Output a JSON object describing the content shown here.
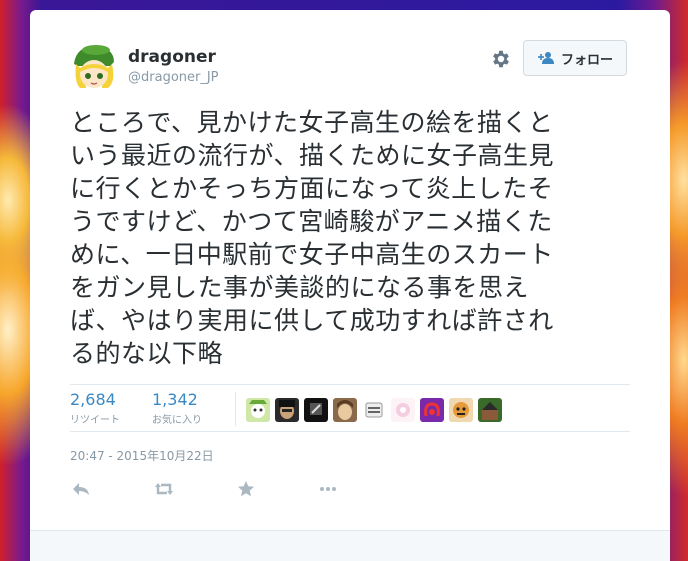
{
  "user": {
    "display_name": "dragoner",
    "handle": "@dragoner_JP"
  },
  "header": {
    "follow_label": "フォロー"
  },
  "tweet": {
    "text": "ところで、見かけた女子高生の絵を描くという最近の流行が、描くために女子高生見に行くとかそっち方面になって炎上したそうですけど、かつて宮崎駿がアニメ描くために、一日中駅前で女子中高生のスカートをガン見した事が美談的になる事を思えば、やはり実用に供して成功すれば許される的な以下略",
    "lines": [
      "ところで、見かけた女子高生の絵を描くと",
      "いう最近の流行が、描くために女子高生見",
      "に行くとかそっち方面になって炎上したそ",
      "うですけど、かつて宮崎駿がアニメ描くた",
      "めに、一日中駅前で女子中高生のスカート",
      "をガン見した事が美談的になる事を思え",
      "ば、やはり実用に供して成功すれば許され",
      "る的な以下略"
    ]
  },
  "stats": {
    "retweets": "2,684",
    "retweets_label": "リツイート",
    "likes": "1,342",
    "likes_label": "お気に入り"
  },
  "timestamp": "20:47 - 2015年10月22日",
  "icons": {
    "settings": "gear-icon",
    "follow": "add-user-icon",
    "reply": "reply-icon",
    "retweet": "retweet-icon",
    "favorite": "star-icon",
    "more": "more-icon"
  },
  "colors": {
    "link": "#3b88c3",
    "muted": "#8899a6",
    "text": "#292f33"
  }
}
